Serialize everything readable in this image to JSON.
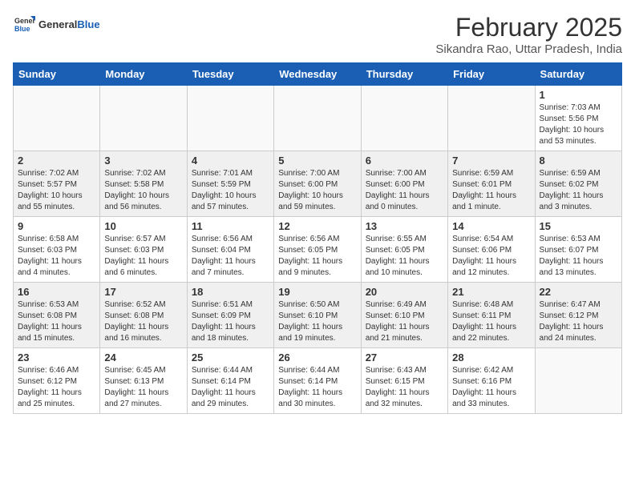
{
  "header": {
    "logo_general": "General",
    "logo_blue": "Blue",
    "month_title": "February 2025",
    "location": "Sikandra Rao, Uttar Pradesh, India"
  },
  "weekdays": [
    "Sunday",
    "Monday",
    "Tuesday",
    "Wednesday",
    "Thursday",
    "Friday",
    "Saturday"
  ],
  "weeks": [
    [
      {
        "day": "",
        "info": ""
      },
      {
        "day": "",
        "info": ""
      },
      {
        "day": "",
        "info": ""
      },
      {
        "day": "",
        "info": ""
      },
      {
        "day": "",
        "info": ""
      },
      {
        "day": "",
        "info": ""
      },
      {
        "day": "1",
        "info": "Sunrise: 7:03 AM\nSunset: 5:56 PM\nDaylight: 10 hours and 53 minutes."
      }
    ],
    [
      {
        "day": "2",
        "info": "Sunrise: 7:02 AM\nSunset: 5:57 PM\nDaylight: 10 hours and 55 minutes."
      },
      {
        "day": "3",
        "info": "Sunrise: 7:02 AM\nSunset: 5:58 PM\nDaylight: 10 hours and 56 minutes."
      },
      {
        "day": "4",
        "info": "Sunrise: 7:01 AM\nSunset: 5:59 PM\nDaylight: 10 hours and 57 minutes."
      },
      {
        "day": "5",
        "info": "Sunrise: 7:00 AM\nSunset: 6:00 PM\nDaylight: 10 hours and 59 minutes."
      },
      {
        "day": "6",
        "info": "Sunrise: 7:00 AM\nSunset: 6:00 PM\nDaylight: 11 hours and 0 minutes."
      },
      {
        "day": "7",
        "info": "Sunrise: 6:59 AM\nSunset: 6:01 PM\nDaylight: 11 hours and 1 minute."
      },
      {
        "day": "8",
        "info": "Sunrise: 6:59 AM\nSunset: 6:02 PM\nDaylight: 11 hours and 3 minutes."
      }
    ],
    [
      {
        "day": "9",
        "info": "Sunrise: 6:58 AM\nSunset: 6:03 PM\nDaylight: 11 hours and 4 minutes."
      },
      {
        "day": "10",
        "info": "Sunrise: 6:57 AM\nSunset: 6:03 PM\nDaylight: 11 hours and 6 minutes."
      },
      {
        "day": "11",
        "info": "Sunrise: 6:56 AM\nSunset: 6:04 PM\nDaylight: 11 hours and 7 minutes."
      },
      {
        "day": "12",
        "info": "Sunrise: 6:56 AM\nSunset: 6:05 PM\nDaylight: 11 hours and 9 minutes."
      },
      {
        "day": "13",
        "info": "Sunrise: 6:55 AM\nSunset: 6:05 PM\nDaylight: 11 hours and 10 minutes."
      },
      {
        "day": "14",
        "info": "Sunrise: 6:54 AM\nSunset: 6:06 PM\nDaylight: 11 hours and 12 minutes."
      },
      {
        "day": "15",
        "info": "Sunrise: 6:53 AM\nSunset: 6:07 PM\nDaylight: 11 hours and 13 minutes."
      }
    ],
    [
      {
        "day": "16",
        "info": "Sunrise: 6:53 AM\nSunset: 6:08 PM\nDaylight: 11 hours and 15 minutes."
      },
      {
        "day": "17",
        "info": "Sunrise: 6:52 AM\nSunset: 6:08 PM\nDaylight: 11 hours and 16 minutes."
      },
      {
        "day": "18",
        "info": "Sunrise: 6:51 AM\nSunset: 6:09 PM\nDaylight: 11 hours and 18 minutes."
      },
      {
        "day": "19",
        "info": "Sunrise: 6:50 AM\nSunset: 6:10 PM\nDaylight: 11 hours and 19 minutes."
      },
      {
        "day": "20",
        "info": "Sunrise: 6:49 AM\nSunset: 6:10 PM\nDaylight: 11 hours and 21 minutes."
      },
      {
        "day": "21",
        "info": "Sunrise: 6:48 AM\nSunset: 6:11 PM\nDaylight: 11 hours and 22 minutes."
      },
      {
        "day": "22",
        "info": "Sunrise: 6:47 AM\nSunset: 6:12 PM\nDaylight: 11 hours and 24 minutes."
      }
    ],
    [
      {
        "day": "23",
        "info": "Sunrise: 6:46 AM\nSunset: 6:12 PM\nDaylight: 11 hours and 25 minutes."
      },
      {
        "day": "24",
        "info": "Sunrise: 6:45 AM\nSunset: 6:13 PM\nDaylight: 11 hours and 27 minutes."
      },
      {
        "day": "25",
        "info": "Sunrise: 6:44 AM\nSunset: 6:14 PM\nDaylight: 11 hours and 29 minutes."
      },
      {
        "day": "26",
        "info": "Sunrise: 6:44 AM\nSunset: 6:14 PM\nDaylight: 11 hours and 30 minutes."
      },
      {
        "day": "27",
        "info": "Sunrise: 6:43 AM\nSunset: 6:15 PM\nDaylight: 11 hours and 32 minutes."
      },
      {
        "day": "28",
        "info": "Sunrise: 6:42 AM\nSunset: 6:16 PM\nDaylight: 11 hours and 33 minutes."
      },
      {
        "day": "",
        "info": ""
      }
    ]
  ]
}
